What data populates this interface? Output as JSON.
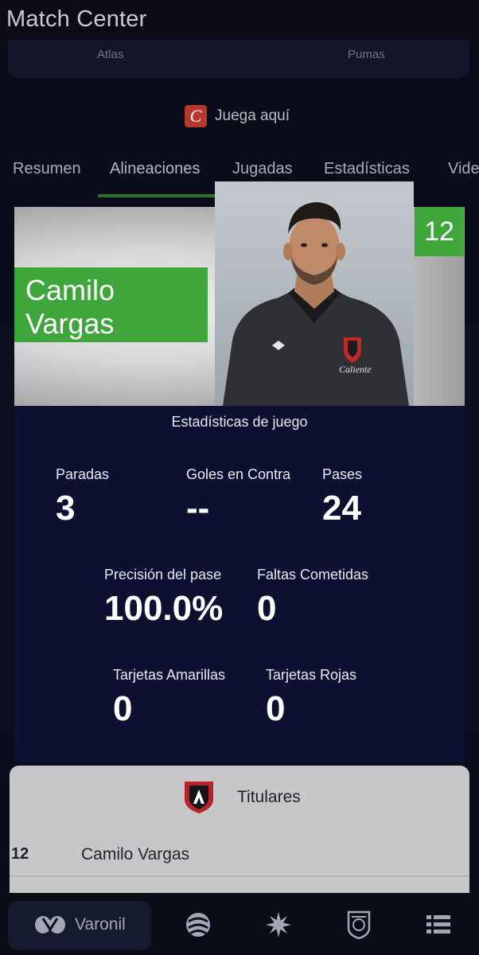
{
  "header": {
    "title": "Match Center"
  },
  "scorecard": {
    "home_team": "Atlas",
    "away_team": "Pumas"
  },
  "play_link": {
    "label": "Juega aquí",
    "icon": "caliente-logo-icon"
  },
  "tabs": [
    {
      "label": "Resumen"
    },
    {
      "label": "Alineaciones",
      "active": true
    },
    {
      "label": "Jugadas"
    },
    {
      "label": "Estadísticas"
    },
    {
      "label": "Vide"
    }
  ],
  "player": {
    "first_name": "Camilo",
    "last_name": "Vargas",
    "number": "12",
    "jersey_sponsor": "Caliente"
  },
  "stats": {
    "heading": "Estadísticas de juego",
    "items": [
      {
        "label": "Paradas",
        "value": "3"
      },
      {
        "label": "Goles en Contra",
        "value": "--"
      },
      {
        "label": "Pases",
        "value": "24"
      },
      {
        "label": "Precisión del pase",
        "value": "100.0%"
      },
      {
        "label": "Faltas Cometidas",
        "value": "0"
      },
      {
        "label": "Tarjetas Amarillas",
        "value": "0"
      },
      {
        "label": "Tarjetas Rojas",
        "value": "0"
      }
    ]
  },
  "lineup": {
    "section_label": "Titulares",
    "crest_icon": "atlas-crest-icon",
    "rows": [
      {
        "number": "12",
        "name": "Camilo Vargas"
      }
    ]
  },
  "bottom_nav": [
    {
      "label": "Varonil",
      "icon": "liga-mx-logo-icon",
      "active": true
    },
    {
      "label": "",
      "icon": "liga-expansion-icon"
    },
    {
      "label": "",
      "icon": "liga-femenil-icon"
    },
    {
      "label": "",
      "icon": "club-crest-icon"
    },
    {
      "label": "",
      "icon": "menu-list-icon"
    }
  ],
  "colors": {
    "background": "#0b0d1c",
    "accent_green": "#3ea63a",
    "stats_panel": "#0d1030",
    "lineup_card": "#c7c7c9"
  }
}
